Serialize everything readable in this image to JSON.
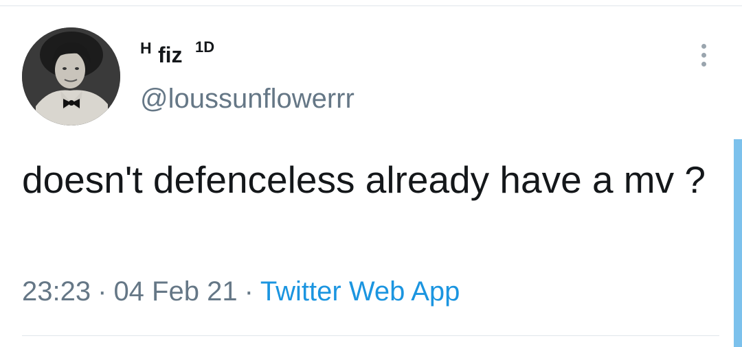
{
  "tweet": {
    "author": {
      "display_name_prefix": "H",
      "display_name_main": "fiz",
      "display_name_super": "1D",
      "handle": "@loussunflowerrr"
    },
    "text": "doesn't defenceless already have a mv ?",
    "time": "23:23",
    "separator": "·",
    "date": "04 Feb 21",
    "source": "Twitter Web App"
  },
  "icons": {
    "more": "more-vertical-icon",
    "avatar": "profile-avatar"
  },
  "colors": {
    "text_primary": "#14171a",
    "text_secondary": "#657786",
    "link": "#1b95e0",
    "divider": "#dfe5ea",
    "scroll_indicator": "#7cc1ec"
  }
}
